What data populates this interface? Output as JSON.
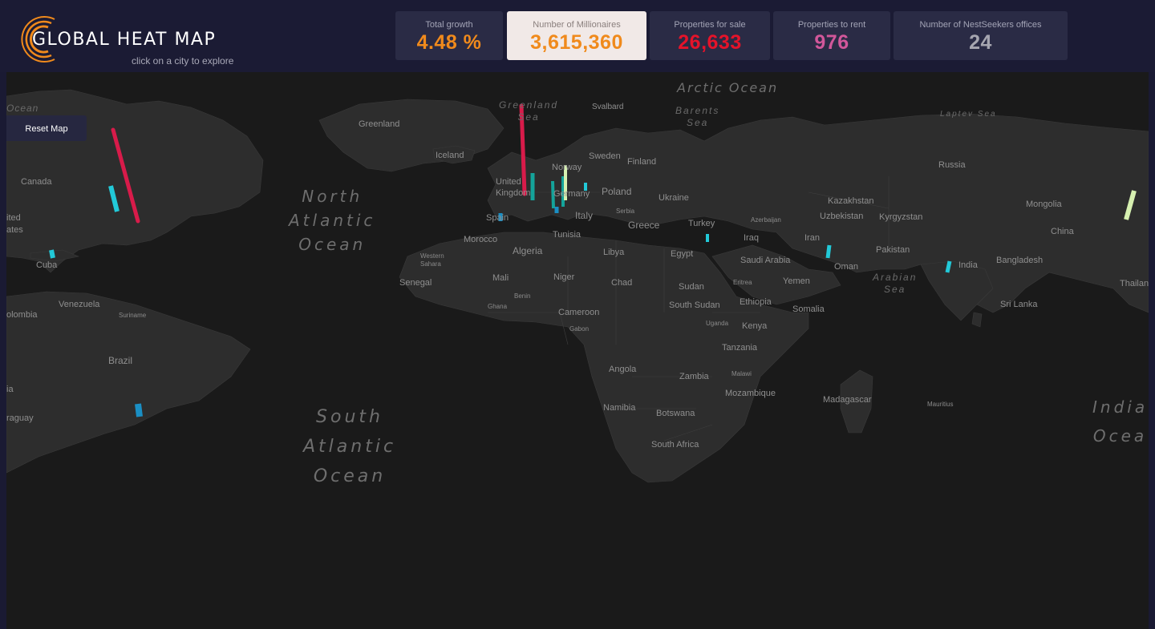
{
  "header": {
    "title": "GLOBAL HEAT MAP",
    "subtitle": "click on a city to explore",
    "accent_color": "#f08a1c"
  },
  "stats": [
    {
      "label": "Total growth",
      "value": "4.48 %",
      "color": "#f08a1c"
    },
    {
      "label": "Number of Millionaires",
      "value": "3,615,360",
      "color": "#f08a1c",
      "active": true
    },
    {
      "label": "Properties for sale",
      "value": "26,633",
      "color": "#e5132a"
    },
    {
      "label": "Properties to rent",
      "value": "976",
      "color": "#d1579a"
    },
    {
      "label": "Number of NestSeekers offices",
      "value": "24",
      "color": "#a6a6b0"
    }
  ],
  "map": {
    "reset_label": "Reset Map",
    "land_color": "#2d2d2d",
    "water_color": "#1a1a1a",
    "oceans": {
      "arctic": "Arctic Ocean",
      "north_atlantic": [
        "North",
        "Atlantic",
        "Ocean"
      ],
      "south_atlantic": [
        "South",
        "Atlantic",
        "Ocean"
      ],
      "indian": [
        "India",
        "Ocea"
      ],
      "ocean_cut": "Ocean"
    },
    "seas": {
      "greenland": [
        "Greenland",
        "Sea"
      ],
      "barents": [
        "Barents",
        "Sea"
      ],
      "laptev": "Laptev Sea",
      "arabian": [
        "Arabian",
        "Sea"
      ]
    },
    "countries": {
      "greenland": "Greenland",
      "svalbard": "Svalbard",
      "canada": "Canada",
      "iceland": "Iceland",
      "sweden": "Sweden",
      "finland": "Finland",
      "russia": "Russia",
      "norway": "Norway",
      "united_kingdom": [
        "United",
        "Kingdom"
      ],
      "poland": "Poland",
      "germany": "Germany",
      "ukraine": "Ukraine",
      "kazakhstan": "Kazakhstan",
      "mongolia": "Mongolia",
      "united_states": [
        "ited",
        "ates"
      ],
      "spain": "Spain",
      "italy": "Italy",
      "serbia": "Serbia",
      "uzbekistan": "Uzbekistan",
      "kyrgyzstan": "Kyrgyzstan",
      "azerbaijan": "Azerbaijan",
      "greece": "Greece",
      "turkey": "Turkey",
      "morocco": "Morocco",
      "tunisia": "Tunisia",
      "china": "China",
      "iraq": "Iraq",
      "iran": "Iran",
      "algeria": "Algeria",
      "libya": "Libya",
      "western_sahara": [
        "Western",
        "Sahara"
      ],
      "egypt": "Egypt",
      "pakistan": "Pakistan",
      "saudi_arabia": "Saudi Arabia",
      "cuba": "Cuba",
      "oman": "Oman",
      "india": "India",
      "bangladesh": "Bangladesh",
      "mali": "Mali",
      "niger": "Niger",
      "chad": "Chad",
      "eritrea": "Eritrea",
      "yemen": "Yemen",
      "senegal": "Senegal",
      "sudan": "Sudan",
      "thailand": "Thailand",
      "benin": "Benin",
      "ethiopia": "Ethiopia",
      "venezuela": "Venezuela",
      "ghana": "Ghana",
      "south_sudan": "South Sudan",
      "sri_lanka": "Sri Lanka",
      "somalia": "Somalia",
      "cameroon": "Cameroon",
      "colombia": "olombia",
      "suriname": "Suriname",
      "uganda": "Uganda",
      "gabon": "Gabon",
      "kenya": "Kenya",
      "tanzania": "Tanzania",
      "brazil": "Brazil",
      "angola": "Angola",
      "zambia": "Zambia",
      "malawi": "Malawi",
      "bolivia": "ia",
      "mozambique": "Mozambique",
      "madagascar": "Madagascar",
      "mauritius": "Mauritius",
      "namibia": "Namibia",
      "botswana": "Botswana",
      "paraguay": "raguay",
      "south_africa": "South Africa"
    },
    "bar_colors": {
      "red": "#d81b4a",
      "teal": "#14a39a",
      "cyan": "#22c9d8",
      "blue": "#1a8fc4",
      "pale": "#d6f0b0"
    }
  }
}
